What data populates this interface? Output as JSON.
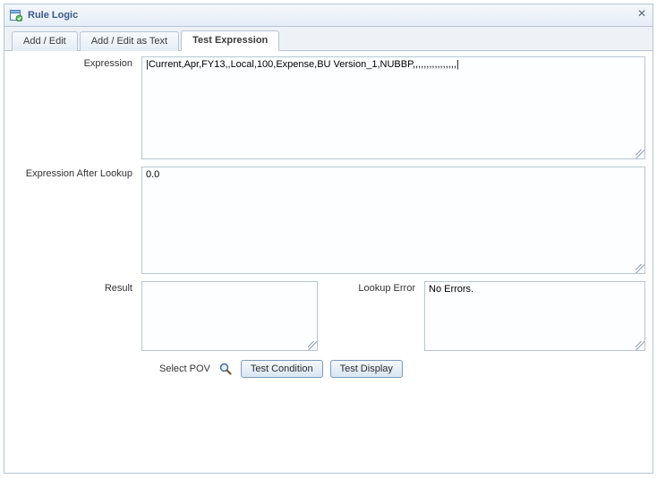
{
  "dialog": {
    "title": "Rule Logic"
  },
  "tabs": {
    "items": [
      {
        "label": "Add / Edit",
        "active": false
      },
      {
        "label": "Add / Edit as Text",
        "active": false
      },
      {
        "label": "Test Expression",
        "active": true
      }
    ]
  },
  "form": {
    "expression_label": "Expression",
    "expression_value": "|Current,Apr,FY13,,Local,100,Expense,BU Version_1,NUBBP,,,,,,,,,,,,,,,,|",
    "expression_after_lookup_label": "Expression After Lookup",
    "expression_after_lookup_value": "0.0",
    "result_label": "Result",
    "result_value": "",
    "lookup_error_label": "Lookup Error",
    "lookup_error_value": "No Errors."
  },
  "actions": {
    "select_pov_label": "Select POV",
    "test_condition_label": "Test Condition",
    "test_display_label": "Test Display"
  }
}
